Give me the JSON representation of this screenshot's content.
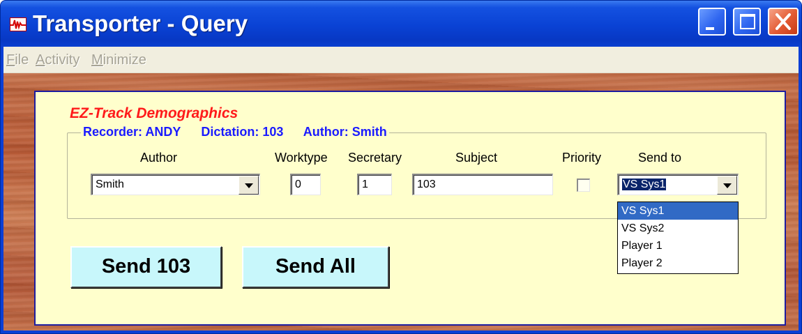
{
  "window": {
    "title": "Transporter - Query",
    "icon": "waveform-icon",
    "controls": [
      "minimize-icon",
      "maximize-icon",
      "close-icon"
    ]
  },
  "menu": {
    "file": {
      "hotkey": "F",
      "rest": "ile"
    },
    "activity": {
      "hotkey": "A",
      "rest": "ctivity"
    },
    "minimize": {
      "hotkey": "M",
      "rest": "inimize"
    }
  },
  "panel": {
    "title": "EZ-Track Demographics",
    "group": {
      "recorder": "Recorder: ANDY",
      "dictation": "Dictation: 103",
      "author": "Author: Smith"
    },
    "columns": {
      "author": "Author",
      "worktype": "Worktype",
      "secretary": "Secretary",
      "subject": "Subject",
      "priority": "Priority",
      "send_to": "Send to"
    },
    "fields": {
      "author": "Smith",
      "worktype": "0",
      "secretary": "1",
      "subject": "103",
      "priority_checked": false,
      "send_to": "VS Sys1"
    },
    "send_to_options": [
      "VS Sys1",
      "VS Sys2",
      "Player 1",
      "Player 2"
    ],
    "buttons": {
      "send_one": "Send 103",
      "send_all": "Send All"
    }
  },
  "colors": {
    "title_accent": "#ff1a1a",
    "legend_text": "#1a1aff",
    "panel_bg": "#ffffcc",
    "button_bg": "#c8f7fb",
    "selection": "#316ac5"
  }
}
